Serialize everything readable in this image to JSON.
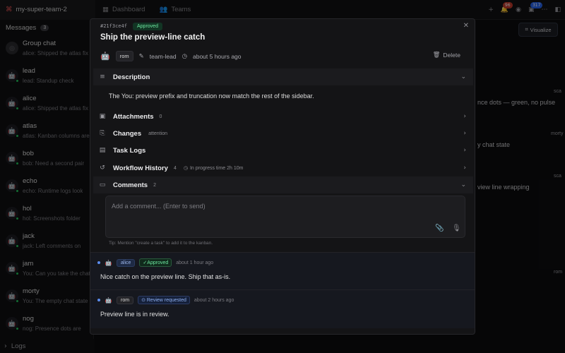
{
  "topbar": {
    "team": "my-super-team-2",
    "tabs": [
      "Dashboard",
      "Teams"
    ],
    "badge_red": "96",
    "badge_blue": "317"
  },
  "sidebar": {
    "title": "Messages",
    "count": "3",
    "items": [
      {
        "name": "Group chat",
        "preview": "alice: Shipped the atlas fix",
        "color": "#6b6b70",
        "icon": "group-icon"
      },
      {
        "name": "lead",
        "preview": "lead: Standup check",
        "color": "#8bc34a"
      },
      {
        "name": "alice",
        "preview": "alice: Shipped the atlas fix",
        "color": "#5b8def"
      },
      {
        "name": "atlas",
        "preview": "atlas: Kanban columns are",
        "color": "#eab308"
      },
      {
        "name": "bob",
        "preview": "bob: Need a second pair",
        "color": "#22c55e"
      },
      {
        "name": "echo",
        "preview": "echo: Runtime logs look",
        "color": "#ef4444"
      },
      {
        "name": "hol",
        "preview": "hol: Screenshots folder",
        "color": "#8b5cf6"
      },
      {
        "name": "jack",
        "preview": "jack: Left comments on",
        "color": "#14b8a6"
      },
      {
        "name": "jam",
        "preview": "You: Can you take the chat",
        "color": "#f97316"
      },
      {
        "name": "morty",
        "preview": "You: The empty chat state",
        "color": "#ec4899"
      },
      {
        "name": "nog",
        "preview": "nog: Presence dots are",
        "color": "#a3a3a3"
      }
    ],
    "footer": "Logs"
  },
  "background": {
    "visualize": "Visualize",
    "lines": [
      "nce dots — green, no pulse",
      "y chat state",
      "view line wrapping"
    ],
    "tags": [
      "sca",
      "morty",
      "sca",
      "rom"
    ]
  },
  "task": {
    "id": "#21f3ce4f",
    "status": "Approved",
    "title": "Ship the preview-line catch",
    "assignee": "rom",
    "creator": "team-lead",
    "time": "about 5 hours ago",
    "delete": "Delete",
    "description_label": "Description",
    "description": "The You: preview prefix and truncation now match the rest of the sidebar.",
    "sections": [
      {
        "label": "Attachments",
        "count": "0",
        "meta": ""
      },
      {
        "label": "Changes",
        "count": "",
        "meta": "attention"
      },
      {
        "label": "Task Logs",
        "count": "",
        "meta": ""
      },
      {
        "label": "Workflow History",
        "count": "4",
        "meta": "In progress time 2h 10m"
      },
      {
        "label": "Comments",
        "count": "2",
        "meta": ""
      }
    ],
    "comment_placeholder": "Add a comment... (Enter to send)",
    "tip": "Tip: Mention \"create a task\" to add it to the kanban.",
    "comments": [
      {
        "user": "alice",
        "badge": "Approved",
        "time": "about 1 hour ago",
        "text": "Nice catch on the preview line. Ship that as-is."
      },
      {
        "user": "rom",
        "badge": "Review requested",
        "time": "about 2 hours ago",
        "text": "Preview line is in review."
      }
    ]
  }
}
